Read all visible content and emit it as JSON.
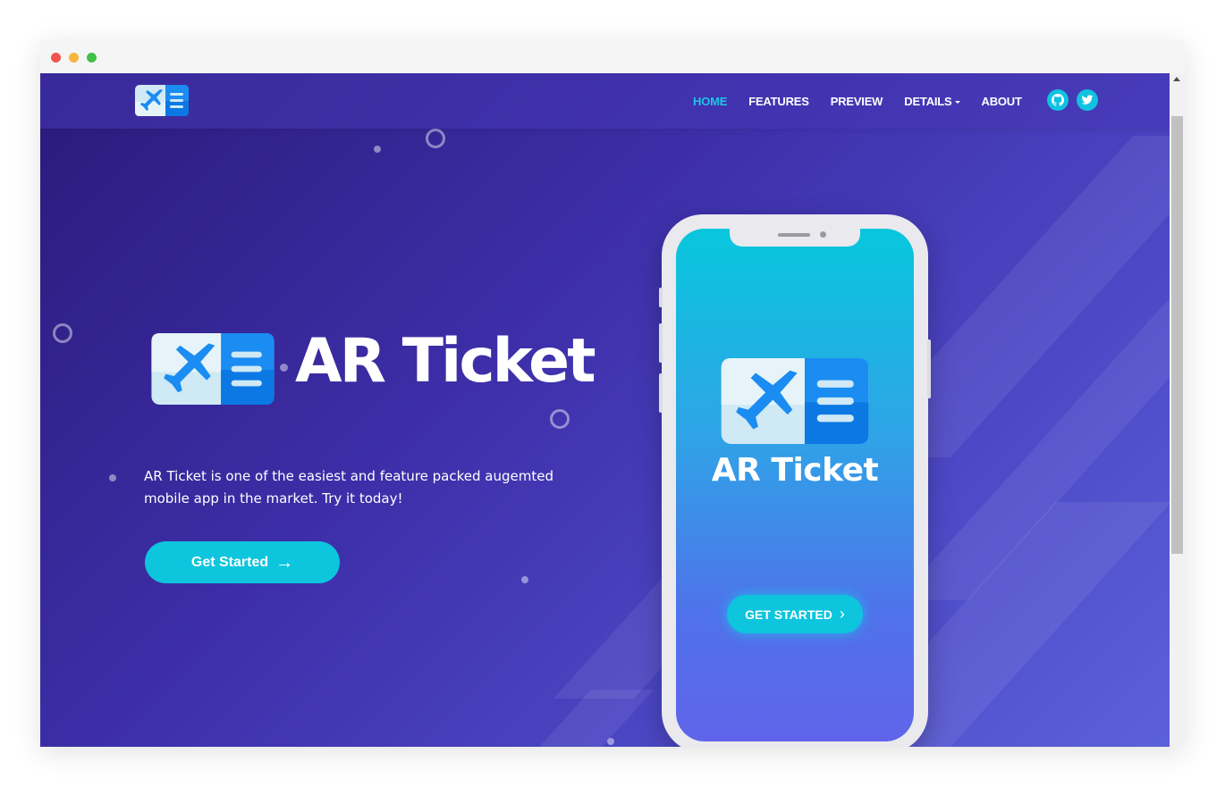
{
  "nav": {
    "items": [
      {
        "label": "HOME",
        "active": true
      },
      {
        "label": "FEATURES",
        "active": false
      },
      {
        "label": "PREVIEW",
        "active": false
      },
      {
        "label": "DETAILS",
        "active": false,
        "has_dropdown": true
      },
      {
        "label": "ABOUT",
        "active": false
      }
    ],
    "social_icons": [
      "github-icon",
      "twitter-icon"
    ]
  },
  "hero": {
    "title": "AR Ticket",
    "description": "AR Ticket is one of the easiest and feature packed augemted mobile app in the market. Try it today!",
    "cta_label": "Get Started"
  },
  "phone": {
    "title": "AR Ticket",
    "cta_label": "GET STARTED"
  },
  "colors": {
    "accent": "#0dc5dd",
    "nav_active": "#1fc5e6",
    "logo_blue": "#1a8cf2",
    "logo_light": "#cfe9f5"
  }
}
